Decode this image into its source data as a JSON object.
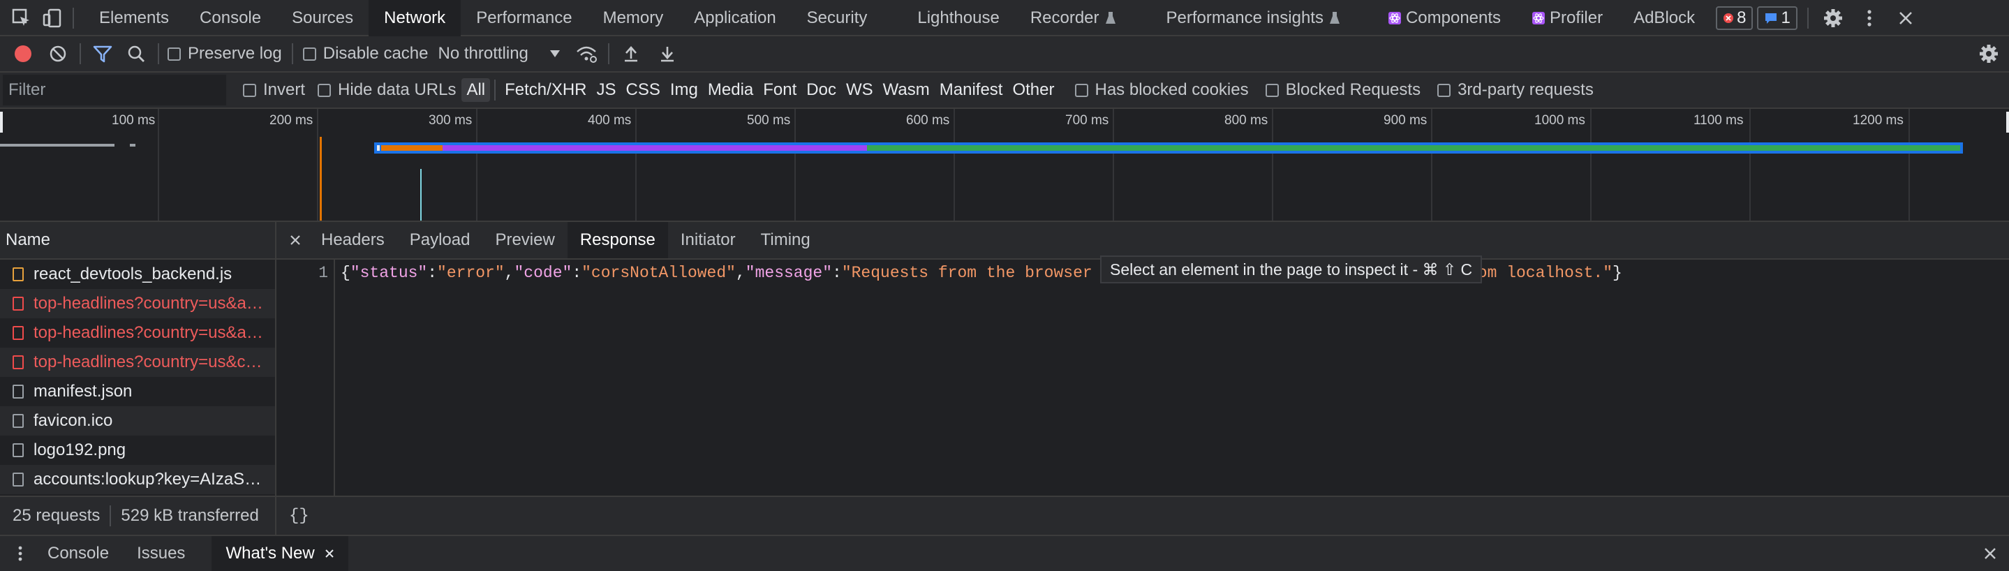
{
  "tabbar": {
    "tabs": [
      {
        "label": "Elements"
      },
      {
        "label": "Console"
      },
      {
        "label": "Sources"
      },
      {
        "label": "Network"
      },
      {
        "label": "Performance"
      },
      {
        "label": "Memory"
      },
      {
        "label": "Application"
      },
      {
        "label": "Security"
      },
      {
        "label": "Lighthouse"
      },
      {
        "label": "Recorder"
      },
      {
        "label": "Performance insights"
      },
      {
        "label": "Components"
      },
      {
        "label": "Profiler"
      },
      {
        "label": "AdBlock"
      }
    ],
    "error_count": "8",
    "message_count": "1"
  },
  "toolbar": {
    "preserve_log": "Preserve log",
    "disable_cache": "Disable cache",
    "throttling": "No throttling"
  },
  "filter": {
    "placeholder": "Filter",
    "invert": "Invert",
    "hide_data_urls": "Hide data URLs",
    "types": [
      "All",
      "Fetch/XHR",
      "JS",
      "CSS",
      "Img",
      "Media",
      "Font",
      "Doc",
      "WS",
      "Wasm",
      "Manifest",
      "Other"
    ],
    "has_blocked_cookies": "Has blocked cookies",
    "blocked_requests": "Blocked Requests",
    "third_party": "3rd-party requests"
  },
  "overview": {
    "ticks": [
      "100 ms",
      "200 ms",
      "300 ms",
      "400 ms",
      "500 ms",
      "600 ms",
      "700 ms",
      "800 ms",
      "900 ms",
      "1000 ms",
      "1100 ms",
      "1200 ms"
    ]
  },
  "requests": {
    "header": "Name",
    "items": [
      {
        "name": "react_devtools_backend.js",
        "status": "js"
      },
      {
        "name": "top-headlines?country=us&a…",
        "status": "error"
      },
      {
        "name": "top-headlines?country=us&a…",
        "status": "error"
      },
      {
        "name": "top-headlines?country=us&c…",
        "status": "error"
      },
      {
        "name": "manifest.json",
        "status": "ok"
      },
      {
        "name": "favicon.ico",
        "status": "ok"
      },
      {
        "name": "logo192.png",
        "status": "ok"
      },
      {
        "name": "accounts:lookup?key=AIzaS…",
        "status": "ok"
      }
    ],
    "summary_requests": "25 requests",
    "summary_transferred": "529 kB transferred"
  },
  "detail": {
    "tabs": [
      "Headers",
      "Payload",
      "Preview",
      "Response",
      "Initiator",
      "Timing"
    ],
    "line_number": "1",
    "code": {
      "k1": "\"status\"",
      "v1": "\"error\"",
      "k2": "\"code\"",
      "v2": "\"corsNotAllowed\"",
      "k3": "\"message\"",
      "v3_start": "\"Requests from the browser are",
      "v3_end": "from localhost.\""
    },
    "tooltip": "Select an element in the page to inspect it - ⌘ ⇧ C",
    "pretty_print": "{}"
  },
  "drawer": {
    "tabs": [
      "Console",
      "Issues",
      "What's New"
    ]
  }
}
